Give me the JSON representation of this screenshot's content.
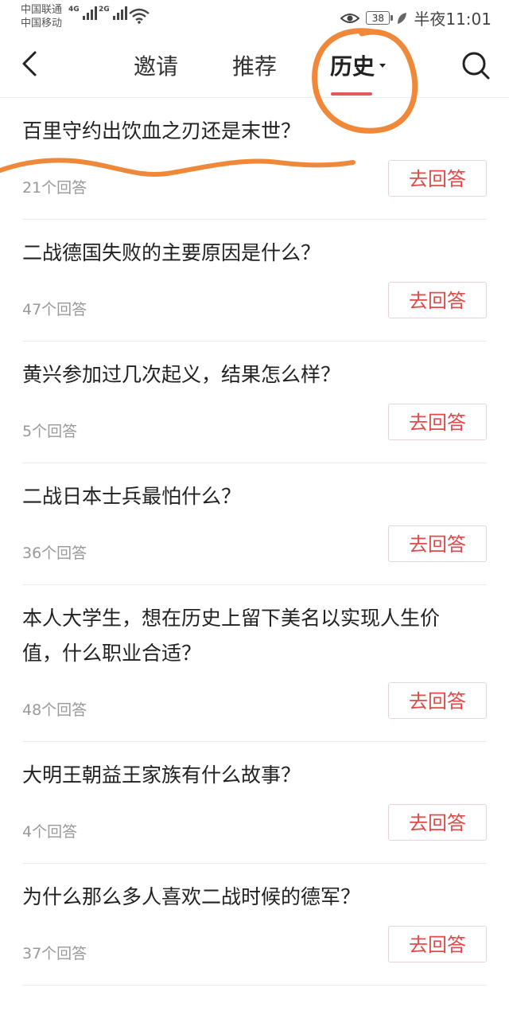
{
  "status_bar": {
    "carrier_1": "中国联通",
    "carrier_2": "中国移动",
    "net_1": "4G",
    "net_2": "2G",
    "battery": "38",
    "time": "半夜11:01"
  },
  "nav": {
    "tabs": [
      {
        "label": "邀请"
      },
      {
        "label": "推荐"
      },
      {
        "label": "历史"
      }
    ]
  },
  "questions": [
    {
      "title": "百里守约出饮血之刃还是末世？",
      "count": "21个回答",
      "button": "去回答"
    },
    {
      "title": "二战德国失败的主要原因是什么？",
      "count": "47个回答",
      "button": "去回答"
    },
    {
      "title": "黄兴参加过几次起义，结果怎么样？",
      "count": "5个回答",
      "button": "去回答"
    },
    {
      "title": "二战日本士兵最怕什么？",
      "count": "36个回答",
      "button": "去回答"
    },
    {
      "title": "本人大学生，想在历史上留下美名以实现人生价值，什么职业合适？",
      "count": "48个回答",
      "button": "去回答"
    },
    {
      "title": "大明王朝益王家族有什么故事？",
      "count": "4个回答",
      "button": "去回答"
    },
    {
      "title": "为什么那么多人喜欢二战时候的德军？",
      "count": "37个回答",
      "button": "去回答"
    }
  ],
  "colors": {
    "accent": "#e45a5a",
    "button_text": "#e04a4a",
    "annotation": "#f0883a"
  },
  "icons": [
    "back-icon",
    "search-icon",
    "eye-icon",
    "leaf-icon",
    "wifi-icon",
    "signal-icon"
  ]
}
